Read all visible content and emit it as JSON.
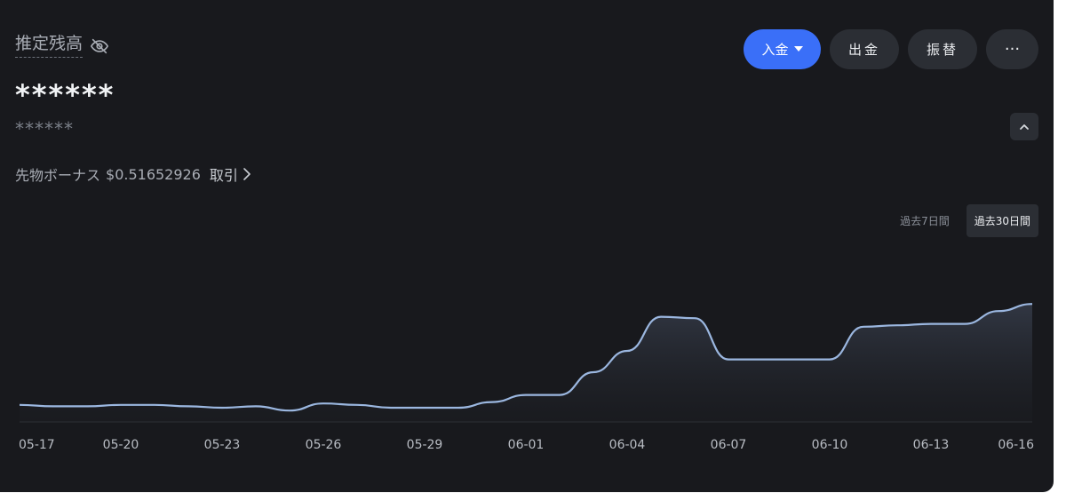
{
  "header": {
    "balance_title": "推定残高",
    "masked_balance": "******",
    "masked_balance_sub": "******"
  },
  "bonus": {
    "label": "先物ボーナス",
    "amount": "$0.51652926",
    "trade_link": "取引"
  },
  "actions": {
    "deposit": "入金",
    "withdraw": "出金",
    "transfer": "振替",
    "more": "···"
  },
  "range": {
    "options": [
      "過去7日間",
      "過去30日間"
    ],
    "selected": "過去30日間"
  },
  "colors": {
    "accent": "#3a6ff8",
    "line": "#9bb7e0",
    "background": "#18191d"
  },
  "chart_data": {
    "type": "area",
    "title": "",
    "xlabel": "",
    "ylabel": "",
    "grid": false,
    "x_ticks": [
      "05-17",
      "05-20",
      "05-23",
      "05-26",
      "05-29",
      "06-01",
      "06-04",
      "06-07",
      "06-10",
      "06-13",
      "06-16"
    ],
    "ylim": [
      0,
      100
    ],
    "x": [
      "05-17",
      "05-18",
      "05-19",
      "05-20",
      "05-21",
      "05-22",
      "05-23",
      "05-24",
      "05-25",
      "05-26",
      "05-27",
      "05-28",
      "05-29",
      "05-30",
      "05-31",
      "06-01",
      "06-02",
      "06-03",
      "06-04",
      "06-05",
      "06-06",
      "06-07",
      "06-08",
      "06-09",
      "06-10",
      "06-11",
      "06-12",
      "06-13",
      "06-14",
      "06-15",
      "06-16"
    ],
    "series": [
      {
        "values": [
          12,
          11,
          11,
          12,
          12,
          11,
          10,
          11,
          8,
          13,
          12,
          10,
          10,
          10,
          14,
          19,
          19,
          35,
          50,
          74,
          73,
          44,
          44,
          44,
          44,
          67,
          68,
          69,
          69,
          78,
          83
        ]
      }
    ]
  }
}
